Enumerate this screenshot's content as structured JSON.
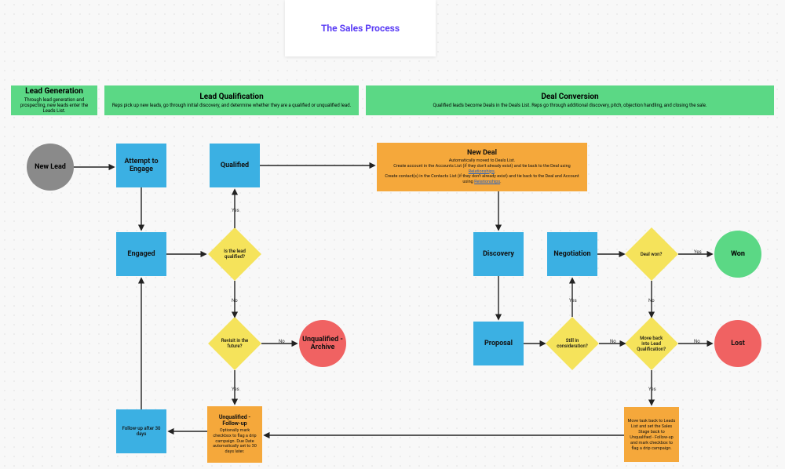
{
  "title": "The Sales Process",
  "phases": {
    "leadGeneration": {
      "title": "Lead Generation",
      "sub": "Through lead generation and prospecting, new leads enter the Leads List."
    },
    "leadQualification": {
      "title": "Lead Qualification",
      "sub": "Reps pick up new leads, go through initial discovery, and determine whether they are a qualified or unqualified lead."
    },
    "dealConversion": {
      "title": "Deal Conversion",
      "sub": "Qualified leads become Deals in the Deals List. Reps go through additional discovery, pitch, objection handling, and closing the sale."
    }
  },
  "nodes": {
    "newLead": "New Lead",
    "attemptEngage": "Attempt to Engage",
    "engaged": "Engaged",
    "followUp30": "Follow-up after 30 days",
    "qualified": "Qualified",
    "isLeadQualified": "Is the lead qualified?",
    "revisitFuture": "Revisit in the future?",
    "unqualifiedArchive": "Unqualified - Archive",
    "unqualifiedFollow": {
      "title": "Unqualified - Follow-up",
      "sub": "Optionally mark checkbox to flag a drip campaign. Due Date automatically set to 30 days later."
    },
    "newDeal": {
      "title": "New Deal",
      "sub": "Automatically moved to Deals List. Create account in the Accounts List (if they don't already exist) and tie back to the Deal using Relationships. Create contact(s) in the Contacts List (if they don't already exist) and tie back to the Deal and Account using Relationships."
    },
    "discovery": "Discovery",
    "proposal": "Proposal",
    "negotiation": "Negotiation",
    "stillConsideration": "Still in consideration?",
    "dealWon": "Deal won?",
    "moveBack": "Move back into Lead Qualification?",
    "won": "Won",
    "lost": "Lost",
    "moveTaskBack": "Move task back to Leads List and set the Sales Stage back to Unqualified - Follow-up and mark checkbox to flag a drip campaign."
  },
  "labels": {
    "yes": "Yes",
    "no": "No"
  },
  "links": {
    "relationships": "Relationships"
  }
}
